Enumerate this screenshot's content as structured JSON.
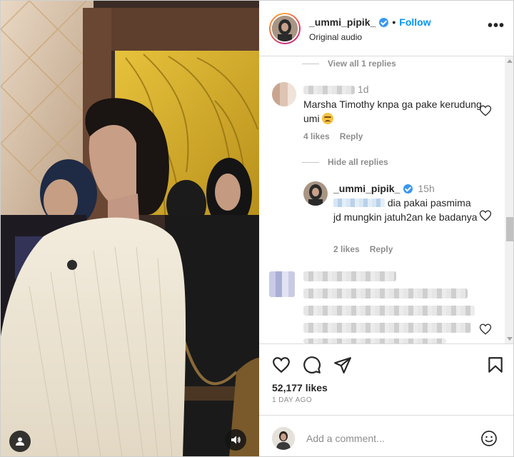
{
  "header": {
    "username": "_ummi_pipik_",
    "separator": "•",
    "follow_label": "Follow",
    "subtitle": "Original audio",
    "more_label": "•••"
  },
  "comments": {
    "view_replies_label": "View all 1 replies",
    "comment1": {
      "time": "1d",
      "text": "Marsha Timothy knpa ga pake kerudung umi",
      "likes": "4 likes",
      "reply_label": "Reply"
    },
    "hide_replies_label": "Hide all replies",
    "reply1": {
      "username": "_ummi_pipik_",
      "time": "15h",
      "text": "dia pakai pasmima jd mungkin jatuh2an ke badanya",
      "likes": "2 likes",
      "reply_label": "Reply"
    }
  },
  "actions": {
    "likes": "52,177 likes",
    "date": "1 DAY AGO"
  },
  "add_comment": {
    "placeholder": "Add a comment..."
  },
  "colors": {
    "accent": "#0095f6",
    "verified": "#3897f0",
    "muted": "#8e8e8e",
    "text": "#262626"
  },
  "icons": [
    "user-tag-icon",
    "sound-icon",
    "verified-icon",
    "more-icon",
    "heart-icon",
    "comment-icon",
    "share-icon",
    "bookmark-icon",
    "emoji-icon"
  ]
}
